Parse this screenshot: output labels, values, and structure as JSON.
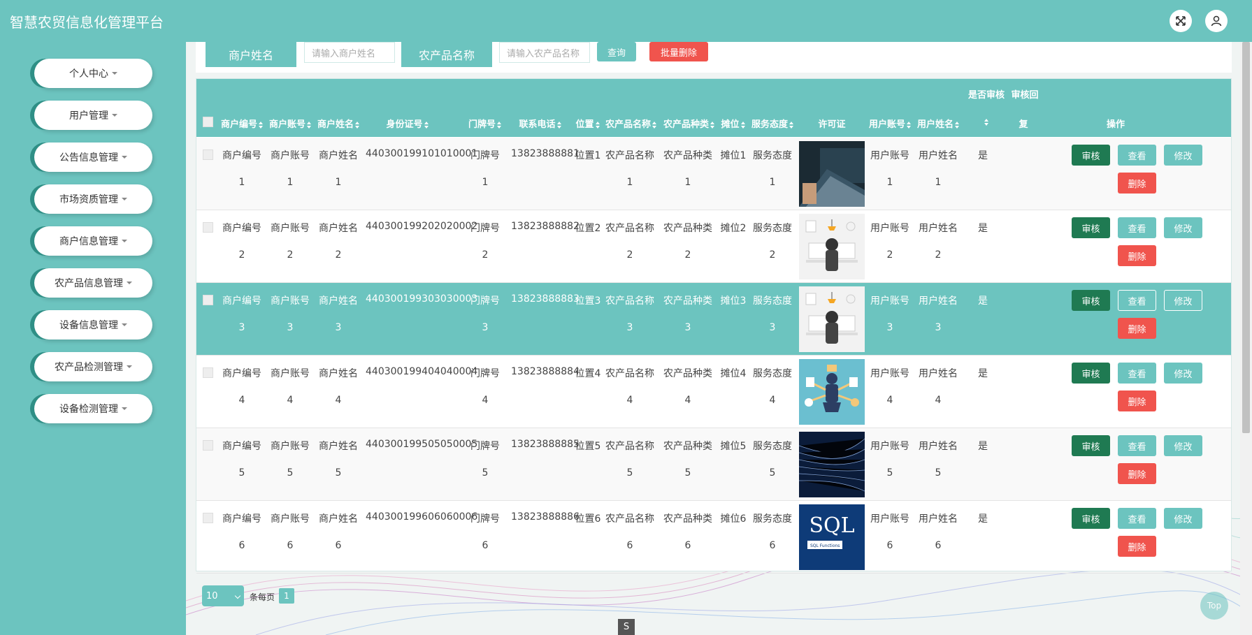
{
  "app": {
    "title": "智慧农贸信息化管理平台"
  },
  "sidebar": {
    "items": [
      {
        "label": "个人中心"
      },
      {
        "label": "用户管理"
      },
      {
        "label": "公告信息管理"
      },
      {
        "label": "市场资质管理"
      },
      {
        "label": "商户信息管理"
      },
      {
        "label": "农产品信息管理"
      },
      {
        "label": "设备信息管理"
      },
      {
        "label": "农产品检测管理"
      },
      {
        "label": "设备检测管理"
      }
    ]
  },
  "search": {
    "merchant_name_label": "商户姓名",
    "merchant_name_placeholder": "请输入商户姓名",
    "product_name_label": "农产品名称",
    "product_name_placeholder": "请输入农产品名称",
    "query_label": "查询",
    "batch_delete_label": "批量删除"
  },
  "table": {
    "headers": {
      "merchant_no": "商户编号",
      "merchant_account": "商户账号",
      "merchant_name": "商户姓名",
      "id_no": "身份证号",
      "door_no": "门牌号",
      "phone": "联系电话",
      "location": "位置",
      "product_name": "农产品名称",
      "product_type": "农产品种类",
      "stall": "摊位",
      "service": "服务态度",
      "license": "许可证",
      "user_account": "用户账号",
      "user_name": "用户姓名",
      "is_audit": "是否审核",
      "audit_reply_top": "审核回",
      "audit_reply_bottom": "复",
      "actions": "操作"
    },
    "rows": [
      {
        "merchant_no": "商户编号",
        "merchant_account": "商户账号",
        "merchant_name": "商户姓名",
        "id_no": "440300199101010001",
        "door_no": "门牌号",
        "phone": "13823888881",
        "location": "位置1",
        "product_name": "农产品名称",
        "product_type": "农产品种类",
        "stall": "摊位1",
        "service": "服务态度",
        "user_account": "用户账号",
        "user_name": "用户姓名",
        "num": "1",
        "is_audit": "是",
        "image": "laptop-photo"
      },
      {
        "merchant_no": "商户编号",
        "merchant_account": "商户账号",
        "merchant_name": "商户姓名",
        "id_no": "440300199202020002",
        "door_no": "门牌号",
        "phone": "13823888882",
        "location": "位置2",
        "product_name": "农产品名称",
        "product_type": "农产品种类",
        "stall": "摊位2",
        "service": "服务态度",
        "user_account": "用户账号",
        "user_name": "用户姓名",
        "num": "2",
        "is_audit": "是",
        "image": "desk-illustration"
      },
      {
        "merchant_no": "商户编号",
        "merchant_account": "商户账号",
        "merchant_name": "商户姓名",
        "id_no": "440300199303030003",
        "door_no": "门牌号",
        "phone": "13823888883",
        "location": "位置3",
        "product_name": "农产品名称",
        "product_type": "农产品种类",
        "stall": "摊位3",
        "service": "服务态度",
        "user_account": "用户账号",
        "user_name": "用户姓名",
        "num": "3",
        "is_audit": "是",
        "image": "desk-illustration"
      },
      {
        "merchant_no": "商户编号",
        "merchant_account": "商户账号",
        "merchant_name": "商户姓名",
        "id_no": "440300199404040004",
        "door_no": "门牌号",
        "phone": "13823888884",
        "location": "位置4",
        "product_name": "农产品名称",
        "product_type": "农产品种类",
        "stall": "摊位4",
        "service": "服务态度",
        "user_account": "用户账号",
        "user_name": "用户姓名",
        "num": "4",
        "is_audit": "是",
        "image": "multitask-illustration"
      },
      {
        "merchant_no": "商户编号",
        "merchant_account": "商户账号",
        "merchant_name": "商户姓名",
        "id_no": "440300199505050005",
        "door_no": "门牌号",
        "phone": "13823888885",
        "location": "位置5",
        "product_name": "农产品名称",
        "product_type": "农产品种类",
        "stall": "摊位5",
        "service": "服务态度",
        "user_account": "用户账号",
        "user_name": "用户姓名",
        "num": "5",
        "is_audit": "是",
        "image": "code-stream-image"
      },
      {
        "merchant_no": "商户编号",
        "merchant_account": "商户账号",
        "merchant_name": "商户姓名",
        "id_no": "440300199606060006",
        "door_no": "门牌号",
        "phone": "13823888886",
        "location": "位置6",
        "product_name": "农产品名称",
        "product_type": "农产品种类",
        "stall": "摊位6",
        "service": "服务态度",
        "user_account": "用户账号",
        "user_name": "用户姓名",
        "num": "6",
        "is_audit": "是",
        "image": "sql-book-cover",
        "image_text": "SQL",
        "image_subtext": "SQL Functions"
      }
    ],
    "actions": {
      "audit": "审核",
      "view": "查看",
      "edit": "修改",
      "delete": "删除"
    }
  },
  "pager": {
    "page_size": "10",
    "per_page_label": "条每页",
    "current_page": "1"
  },
  "misc": {
    "top_label": "Top",
    "bottom_tag": "S"
  },
  "colors": {
    "primary": "#6cc4bf",
    "audit": "#1f7a52",
    "danger": "#f0544d"
  }
}
